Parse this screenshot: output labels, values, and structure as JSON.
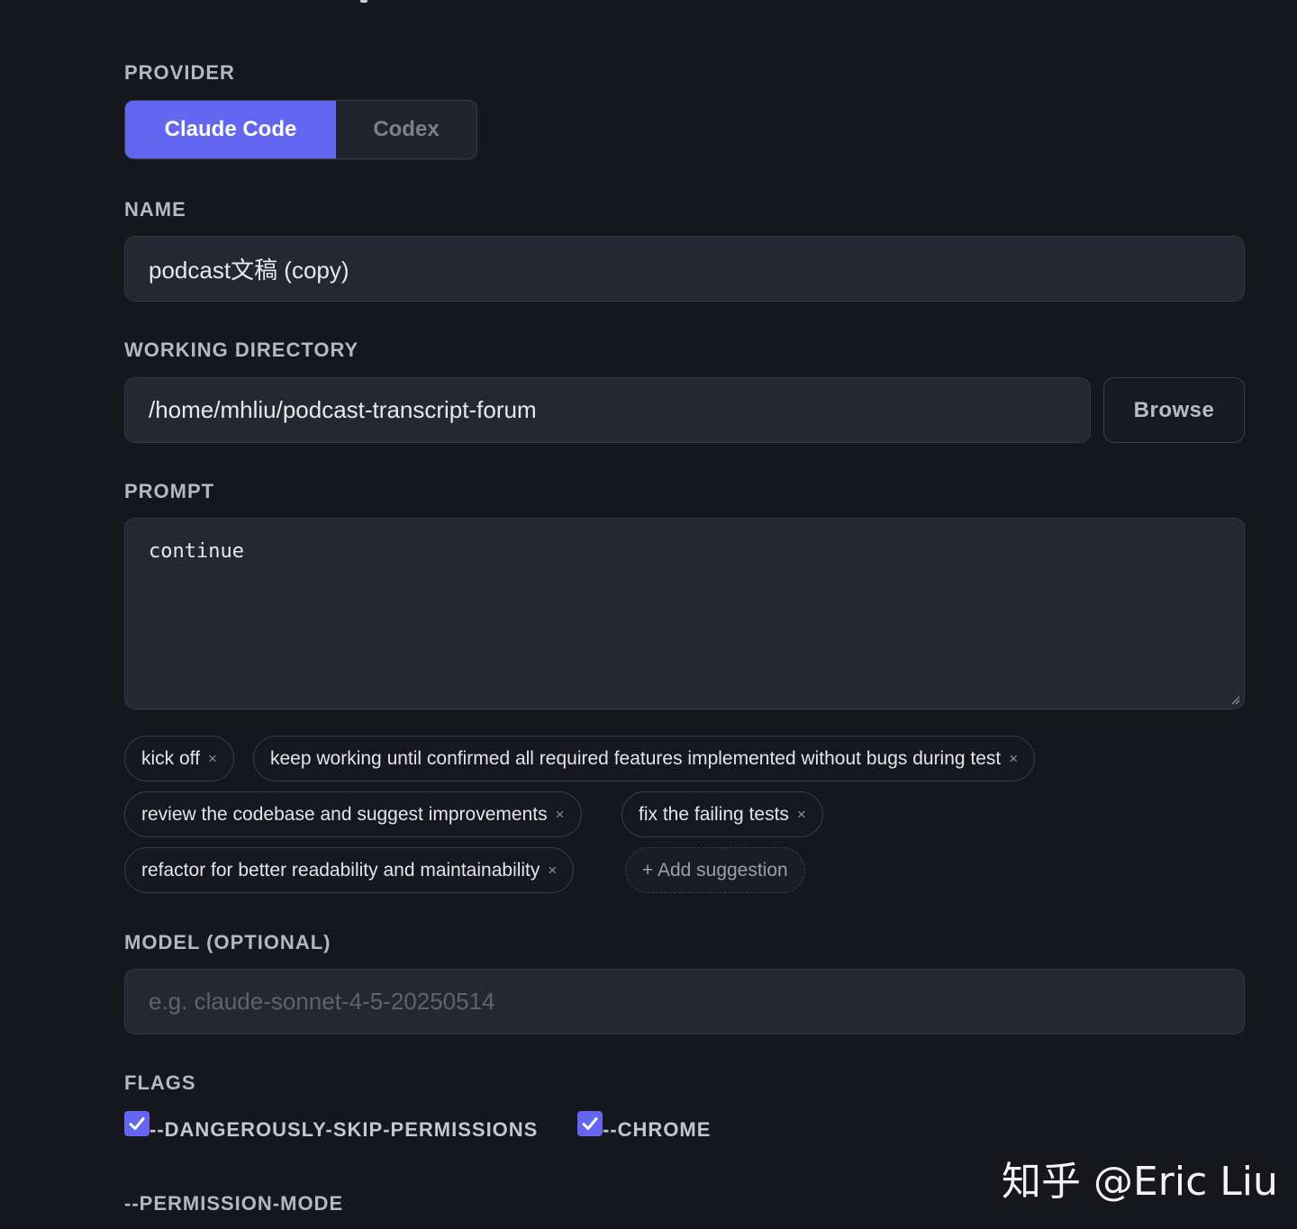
{
  "provider": {
    "label": "PROVIDER",
    "options": [
      "Claude Code",
      "Codex"
    ],
    "selected": "Claude Code"
  },
  "name": {
    "label": "NAME",
    "value": "podcast文稿 (copy)"
  },
  "working_directory": {
    "label": "WORKING DIRECTORY",
    "value": "/home/mhliu/podcast-transcript-forum",
    "browse_label": "Browse"
  },
  "prompt": {
    "label": "PROMPT",
    "value": "continue",
    "suggestions": [
      "kick off",
      "keep working until confirmed all required features implemented without bugs during test",
      "review the codebase and suggest improvements",
      "fix the failing tests",
      "refactor for better readability and maintainability"
    ],
    "remove_glyph": "×",
    "add_label": "+ Add suggestion"
  },
  "model": {
    "label": "MODEL (OPTIONAL)",
    "placeholder": "e.g. claude-sonnet-4-5-20250514"
  },
  "flags": {
    "label": "FLAGS",
    "items": [
      {
        "label": "--DANGEROUSLY-SKIP-PERMISSIONS",
        "checked": true
      },
      {
        "label": "--CHROME",
        "checked": true
      }
    ]
  },
  "permission_mode": {
    "label": "--PERMISSION-MODE"
  },
  "watermark": "知乎 @Eric Liu",
  "colors": {
    "background": "#16171d",
    "accent": "#6366f1",
    "field_bg": "#252833"
  }
}
